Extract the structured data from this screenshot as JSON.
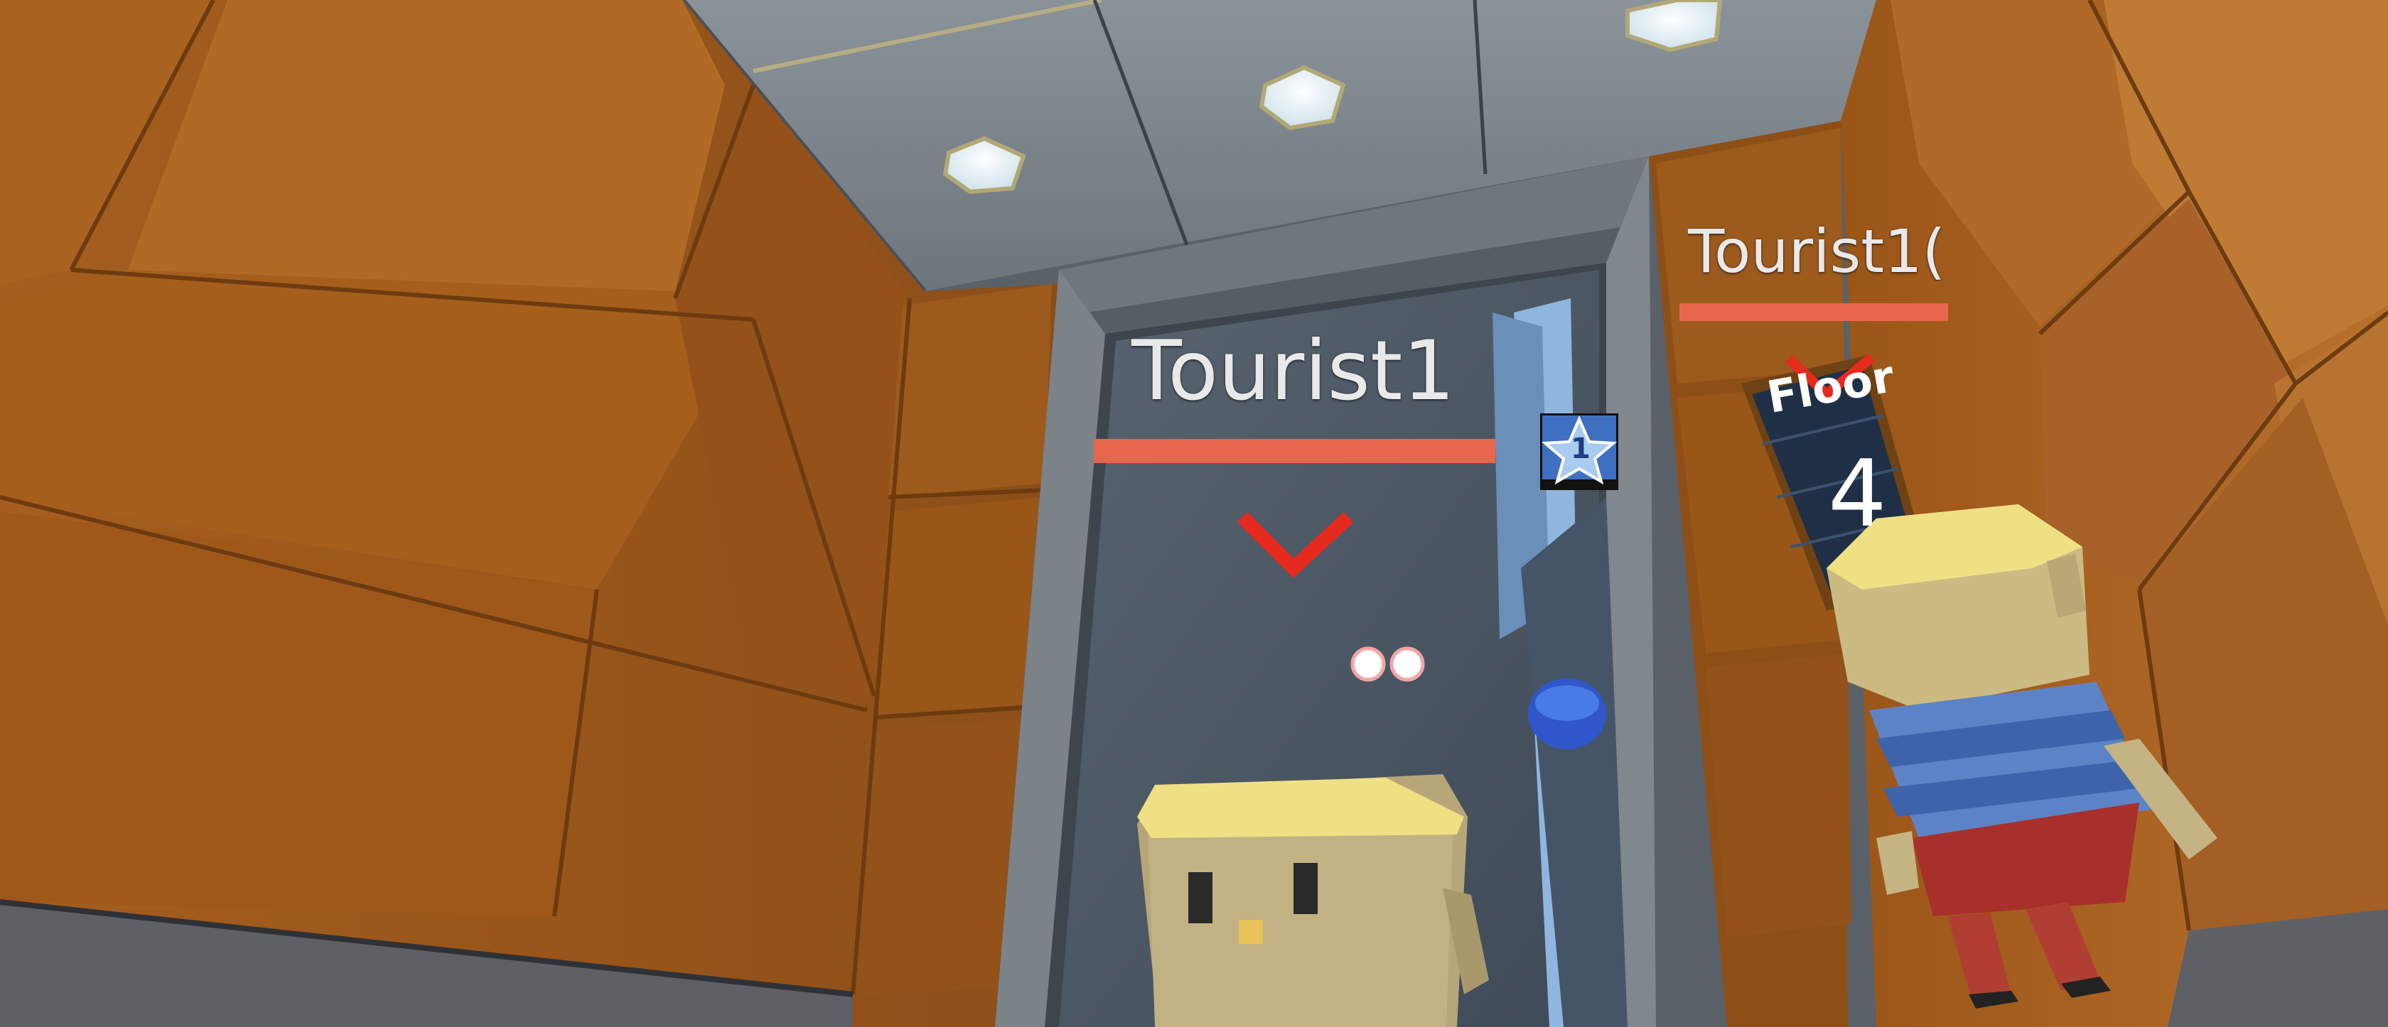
{
  "hud": {
    "player_name": "Tourist1",
    "other_player_name": "Tourist1(",
    "rank_badge_number": "1"
  },
  "elevator_display": {
    "label": "Floor",
    "floor_number": "4"
  },
  "colors": {
    "wall_wood": "#b46a24",
    "wall_wood_dark": "#7a4412",
    "frame_gray": "#6f767c",
    "ceiling_gray": "#7b848c",
    "health_bar": "#e8674c",
    "target_marker": "#e62a1e",
    "badge_blue": "#3f6fc1",
    "display_bg": "#22344a"
  },
  "icons": [
    "chevron-down-icon",
    "star-badge-icon"
  ]
}
